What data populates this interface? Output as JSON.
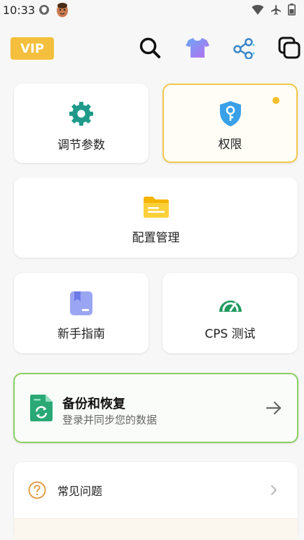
{
  "status_bar": {
    "time": "10:33"
  },
  "top_bar": {
    "vip_label": "VIP"
  },
  "cards": {
    "tune": "调节参数",
    "permissions": "权限",
    "config": "配置管理",
    "guide": "新手指南",
    "cps": "CPS 测试"
  },
  "backup": {
    "title": "备份和恢复",
    "subtitle": "登录并同步您的数据"
  },
  "faq": {
    "label": "常见问题"
  },
  "colors": {
    "vip": "#f3bf3c",
    "teal": "#1f9a8a",
    "blue": "#3aa0e8",
    "yellow": "#f3bf2c",
    "green_border": "#8bcf63"
  }
}
